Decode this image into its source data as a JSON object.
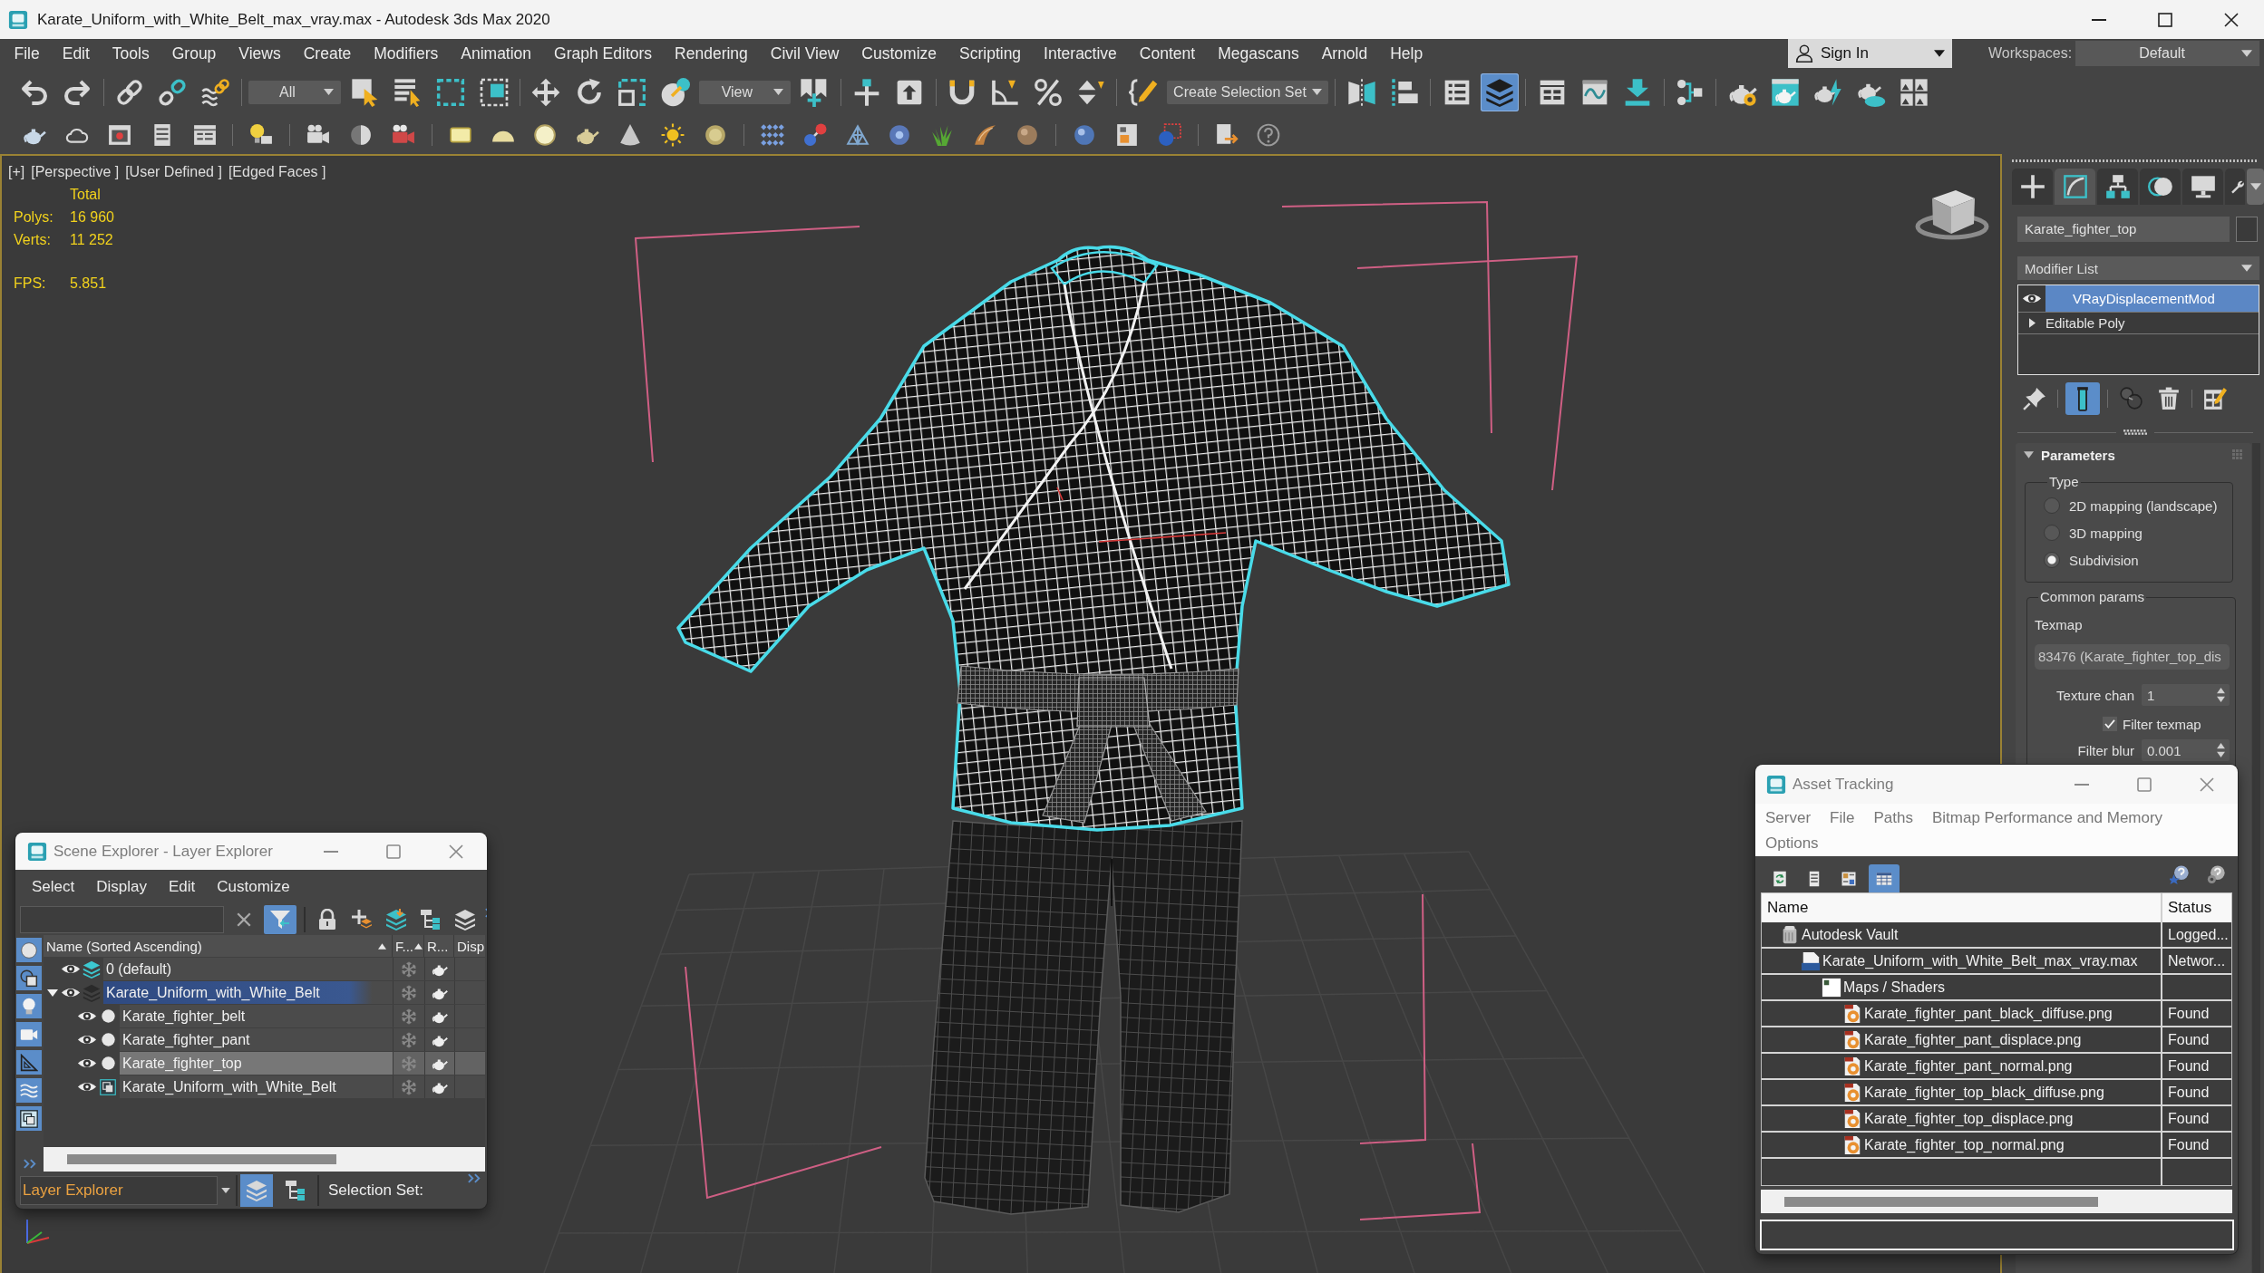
{
  "window": {
    "title": "Karate_Uniform_with_White_Belt_max_vray.max - Autodesk 3ds Max 2020"
  },
  "menu_bar": {
    "items": [
      "File",
      "Edit",
      "Tools",
      "Group",
      "Views",
      "Create",
      "Modifiers",
      "Animation",
      "Graph Editors",
      "Rendering",
      "Civil View",
      "Customize",
      "Scripting",
      "Interactive",
      "Content",
      "Megascans",
      "Arnold",
      "Help"
    ],
    "sign_in": "Sign In",
    "workspaces": {
      "label": "Workspaces:",
      "value": "Default"
    }
  },
  "main_toolbar": {
    "buttons": [
      {
        "active": false
      },
      {
        "active": false
      },
      {
        "active": false
      },
      {
        "active": false
      },
      {
        "active": false
      },
      {
        "active": false
      },
      {
        "active": false
      },
      {
        "active": false
      },
      {
        "active": false
      },
      {
        "active": false
      },
      {
        "active": false
      },
      {
        "active": false
      },
      {
        "active": false
      },
      {
        "active": false
      },
      {
        "active": false
      },
      {
        "active": false
      },
      {
        "active": false
      },
      {
        "active": false
      },
      {
        "active": false
      },
      {
        "active": false
      },
      {
        "active": false
      },
      {
        "active": false
      },
      {
        "active": false
      },
      {
        "active": false
      },
      {
        "active": true
      },
      {
        "active": false
      },
      {
        "active": false
      },
      {
        "active": false
      },
      {
        "active": false
      },
      {
        "active": false
      },
      {
        "active": false
      },
      {
        "active": false
      },
      {
        "active": false
      },
      {
        "active": false
      }
    ],
    "dropdowns": [
      "All",
      "View",
      "Create Selection Set"
    ]
  },
  "viewport": {
    "labels": [
      "[+]",
      "[Perspective ]",
      "[User Defined ]",
      "[Edged Faces ]"
    ],
    "stats": {
      "heading": "Total",
      "rows": [
        {
          "kind": "count",
          "label": "Polys:",
          "value": "16 960"
        },
        {
          "kind": "count",
          "label": "Verts:",
          "value": "11 252"
        },
        {
          "kind": "rate",
          "label": "FPS:",
          "value": "5.851"
        }
      ]
    }
  },
  "command_panel": {
    "tabs": [
      {
        "selected": false
      },
      {
        "selected": true
      },
      {
        "selected": false
      },
      {
        "selected": false
      },
      {
        "selected": false
      },
      {
        "selected": false
      }
    ],
    "object_name": "Karate_fighter_top",
    "modifier_list": "Modifier List",
    "stack": [
      {
        "kind": "modifier",
        "name": "VRayDisplacementMod",
        "selected": true,
        "enabled": true
      },
      {
        "kind": "base",
        "name": "Editable Poly",
        "selected": false,
        "expanded": false
      }
    ],
    "stack_buttons": [
      {
        "active": false
      },
      {
        "active": true
      },
      {
        "active": false
      },
      {
        "active": false
      },
      {
        "active": false
      }
    ],
    "rollout": {
      "title": "Parameters",
      "expanded": true,
      "type_group": {
        "label": "Type",
        "options": [
          {
            "label": "2D mapping (landscape)",
            "selected": false
          },
          {
            "label": "3D mapping",
            "selected": false
          },
          {
            "label": "Subdivision",
            "selected": true
          }
        ]
      },
      "common_group": {
        "label": "Common params",
        "texmap_label": "Texmap",
        "texmap": "83476 (Karate_fighter_top_dis",
        "texture_chan": {
          "label": "Texture chan",
          "value": "1"
        },
        "filter_texmap": {
          "label": "Filter texmap",
          "checked": true
        },
        "filter_blur": {
          "label": "Filter blur",
          "value": "0.001"
        }
      }
    }
  },
  "scene_explorer": {
    "title": "Scene Explorer - Layer Explorer",
    "menu": [
      "Select",
      "Display",
      "Edit",
      "Customize"
    ],
    "toolbar": [
      {
        "active": false
      },
      {
        "active": true
      },
      {
        "active": false
      },
      {
        "active": false
      },
      {
        "active": false
      },
      {
        "active": false
      },
      {
        "active": false
      }
    ],
    "side_buttons": [
      {
        "active": true
      },
      {
        "active": true
      },
      {
        "active": true
      },
      {
        "active": true
      },
      {
        "active": true
      },
      {
        "active": true
      },
      {
        "active": true
      }
    ],
    "columns": [
      {
        "label": "Name (Sorted Ascending)",
        "sorted": true
      },
      {
        "label": "F...",
        "sorted": true
      },
      {
        "label": "R...",
        "sorted": false
      },
      {
        "label": "Disp",
        "sorted": false
      }
    ],
    "rows": [
      {
        "kind": "layer",
        "name": "0 (default)",
        "current": true,
        "selected": false,
        "visible": true,
        "frozen": false,
        "renderable": true
      },
      {
        "kind": "layer",
        "name": "Karate_Uniform_with_White_Belt",
        "current": false,
        "selected": true,
        "expanded": true,
        "visible": true,
        "frozen": false,
        "renderable": true,
        "children": [
          {
            "kind": "object",
            "name": "Karate_fighter_belt",
            "selected": false,
            "visible": true,
            "frozen": false,
            "renderable": true
          },
          {
            "kind": "object",
            "name": "Karate_fighter_pant",
            "selected": false,
            "visible": true,
            "frozen": false,
            "renderable": true
          },
          {
            "kind": "object",
            "name": "Karate_fighter_top",
            "selected": true,
            "visible": true,
            "frozen": false,
            "renderable": true
          },
          {
            "kind": "group",
            "name": "Karate_Uniform_with_White_Belt",
            "selected": false,
            "visible": true,
            "frozen": false,
            "renderable": true
          }
        ]
      }
    ],
    "footer": {
      "explorer": "Layer Explorer",
      "mode_buttons": [
        {
          "active": true
        },
        {
          "active": false
        }
      ],
      "selection_set": "Selection Set:"
    }
  },
  "asset_tracking": {
    "title": "Asset Tracking",
    "menu": [
      "Server",
      "File",
      "Paths",
      "Bitmap Performance and Memory",
      "Options"
    ],
    "toolbar": [
      {
        "active": false
      },
      {
        "active": false
      },
      {
        "active": false
      },
      {
        "active": true
      }
    ],
    "columns": [
      "Name",
      "Status"
    ],
    "rows": [
      {
        "kind": "vault",
        "name": "Autodesk Vault",
        "status": "Logged...",
        "children": [
          {
            "kind": "scene-file",
            "name": "Karate_Uniform_with_White_Belt_max_vray.max",
            "status": "Networ...",
            "children": [
              {
                "kind": "folder",
                "name": "Maps / Shaders",
                "children": [
                  {
                    "kind": "bitmap",
                    "name": "Karate_fighter_pant_black_diffuse.png",
                    "status": "Found"
                  },
                  {
                    "kind": "bitmap",
                    "name": "Karate_fighter_pant_displace.png",
                    "status": "Found"
                  },
                  {
                    "kind": "bitmap",
                    "name": "Karate_fighter_pant_normal.png",
                    "status": "Found"
                  },
                  {
                    "kind": "bitmap",
                    "name": "Karate_fighter_top_black_diffuse.png",
                    "status": "Found"
                  },
                  {
                    "kind": "bitmap",
                    "name": "Karate_fighter_top_displace.png",
                    "status": "Found"
                  },
                  {
                    "kind": "bitmap",
                    "name": "Karate_fighter_top_normal.png",
                    "status": "Found"
                  }
                ]
              }
            ]
          }
        ]
      }
    ]
  }
}
